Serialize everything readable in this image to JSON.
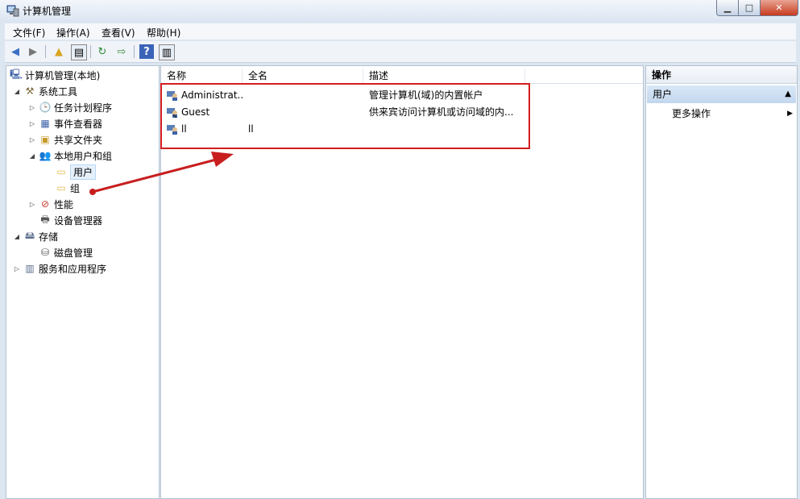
{
  "window": {
    "title": "计算机管理",
    "minimize": "▁",
    "maximize": "□",
    "close": "✕"
  },
  "menu": [
    "文件(F)",
    "操作(A)",
    "查看(V)",
    "帮助(H)"
  ],
  "toolbar": {
    "icons": [
      "back-arrow-icon",
      "forward-arrow-icon",
      "up-folder-icon",
      "show-hide-tree-icon",
      "refresh-icon",
      "export-list-icon",
      "help-icon",
      "show-hide-action-pane-icon"
    ]
  },
  "tree": {
    "root": "计算机管理(本地)",
    "system_tools": "系统工具",
    "task_scheduler": "任务计划程序",
    "event_viewer": "事件查看器",
    "shared_folders": "共享文件夹",
    "local_users_groups": "本地用户和组",
    "users": "用户",
    "groups": "组",
    "performance": "性能",
    "device_manager": "设备管理器",
    "storage": "存储",
    "disk_management": "磁盘管理",
    "services_apps": "服务和应用程序"
  },
  "list": {
    "columns": [
      "名称",
      "全名",
      "描述"
    ],
    "rows": [
      {
        "name": "Administrat...",
        "fullname": "",
        "desc": "管理计算机(域)的内置帐户"
      },
      {
        "name": "Guest",
        "fullname": "",
        "desc": "供来宾访问计算机或访问域的内..."
      },
      {
        "name": "ll",
        "fullname": "ll",
        "desc": ""
      }
    ]
  },
  "actions": {
    "header": "操作",
    "section": "用户",
    "more": "更多操作"
  },
  "colors": {
    "highlight": "#d21e1e",
    "selection": "#e5f0fb"
  }
}
